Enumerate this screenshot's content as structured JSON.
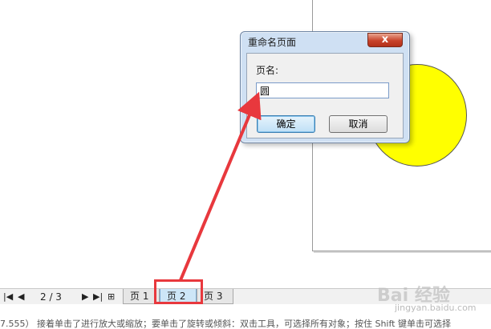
{
  "dialog": {
    "title": "重命名页面",
    "close_symbol": "x",
    "field_label": "页名:",
    "input_value": "圆",
    "ok_label": "确定",
    "cancel_label": "取消"
  },
  "navbar": {
    "page_counter": "2 / 3",
    "tabs": [
      {
        "label": "页 1"
      },
      {
        "label": "页 2"
      },
      {
        "label": "页 3"
      }
    ]
  },
  "colors": {
    "shape_fill": "#ffff00",
    "highlight": "#e8383d",
    "arrow": "#e8383d"
  },
  "status_line": "7.555） 接着单击了进行放大或缩放；要单击了旋转或倾斜：双击工具，可选择所有对象；按住 Shift 键单击可选择",
  "watermark": {
    "brand": "Bai 经验",
    "sub": "jingyan.baidu.com"
  }
}
